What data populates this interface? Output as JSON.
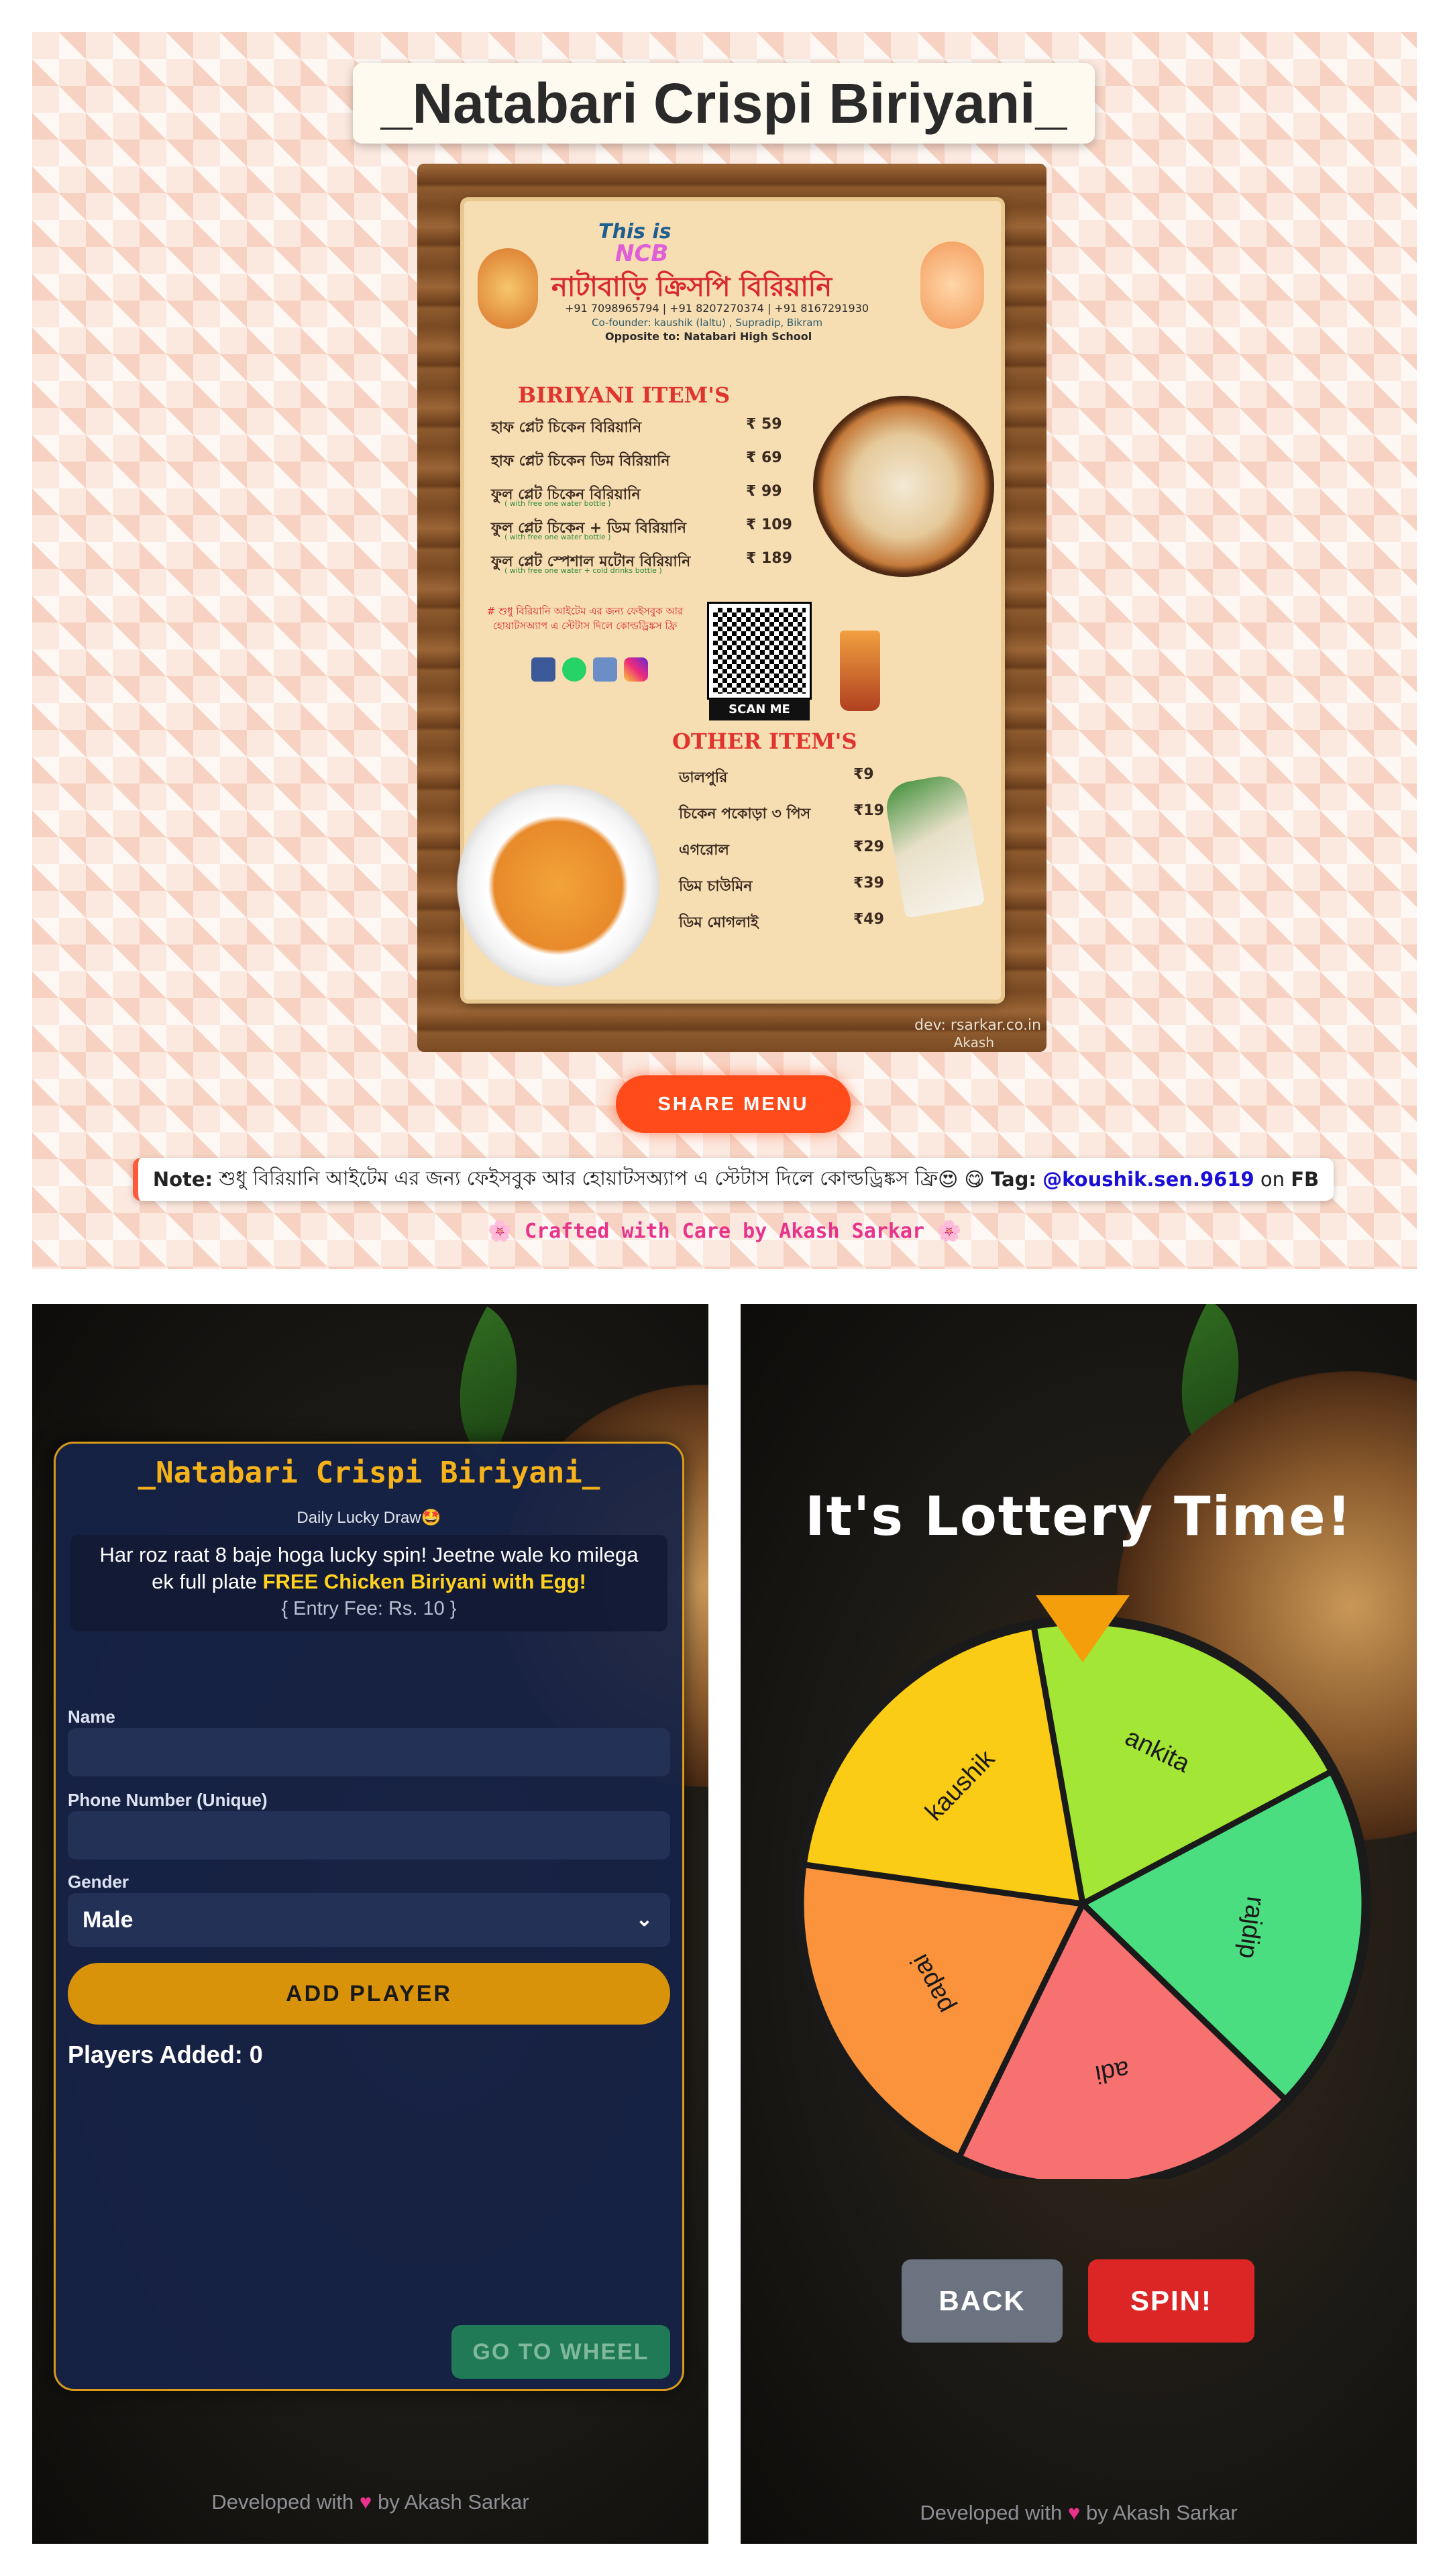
{
  "top": {
    "title": "_Natabari Crispi Biriyani_",
    "menu": {
      "this_is": "This is",
      "ncb": "NCB",
      "restaurant_bengali": "নাটাবাড়ি ক্রিসপি বিরিয়ানি",
      "phones": "+91 7098965794 | +91 8207270374 | +91 8167291930",
      "cofounder": "Co-founder: kaushik (laltu) , Supradip, Bikram",
      "opposite": "Opposite to: Natabari High School",
      "biriyani_heading": "BIRIYANI ITEM'S",
      "biriyani_items": [
        {
          "name": "হাফ প্লেট চিকেন বিরিয়ানি",
          "price": "₹ 59",
          "sub": ""
        },
        {
          "name": "হাফ প্লেট চিকেন ডিম বিরিয়ানি",
          "price": "₹ 69",
          "sub": ""
        },
        {
          "name": "ফুল প্লেট চিকেন বিরিয়ানি",
          "price": "₹ 99",
          "sub": "( with free one water bottle )"
        },
        {
          "name": "ফুল প্লেট চিকেন + ডিম বিরিয়ানি",
          "price": "₹ 109",
          "sub": "( with free one water bottle )"
        },
        {
          "name": "ফুল প্লেট স্পেশাল মটোন বিরিয়ানি",
          "price": "₹ 189",
          "sub": "( with free one water + cold drinks bottle )"
        }
      ],
      "promo_text": "# শুধু বিরিয়ানি আইটেম এর জন্য ফেইসবুক আর হোয়াটসঅ্যাপ এ স্টেটাস দিলে কোল্ডড্রিঙ্কস ফ্রি",
      "scan_me": "SCAN ME",
      "other_heading": "OTHER ITEM'S",
      "other_items": [
        {
          "name": "ডালপুরি",
          "price": "₹9"
        },
        {
          "name": "চিকেন পকোড়া ৩ পিস",
          "price": "₹19"
        },
        {
          "name": "এগরোল",
          "price": "₹29"
        },
        {
          "name": "ডিম চাউমিন",
          "price": "₹39"
        },
        {
          "name": "ডিম মোগলাই",
          "price": "₹49"
        }
      ],
      "dev": "dev: rsarkar.co.in",
      "dev_name": "Akash"
    },
    "share_label": "SHARE MENU",
    "note": {
      "label": "Note:",
      "text": "শুধু বিরিয়ানি আইটেম এর জন্য ফেইসবুক আর হোয়াটসঅ্যাপ এ স্টেটাস দিলে কোল্ডড্রিঙ্কস ফ্রি",
      "emoji": "😍 😋",
      "tag_label": "Tag:",
      "tag_handle": "@koushik.sen.9619",
      "tag_on": "on",
      "tag_platform": "FB"
    },
    "crafted": "🌸 Crafted with Care by Akash Sarkar 🌸"
  },
  "left": {
    "title": "_Natabari Crispi Biriyani_",
    "subtitle": "Daily Lucky Draw🤩",
    "promo_line1": "Har roz raat 8 baje hoga lucky spin! Jeetne wale ko milega",
    "promo_line2a": "ek full plate",
    "promo_highlight": "FREE Chicken Biriyani with Egg!",
    "entry_fee": "{ Entry Fee: Rs. 10 }",
    "name_label": "Name",
    "name_value": "",
    "phone_label": "Phone Number (Unique)",
    "phone_value": "",
    "gender_label": "Gender",
    "gender_value": "Male",
    "add_player": "ADD PLAYER",
    "players_added": "Players Added: 0",
    "go_to_wheel": "GO TO WHEEL",
    "developed_prefix": "Developed with",
    "developed_suffix": "by Akash Sarkar"
  },
  "right": {
    "title": "It's Lottery Time!",
    "wheel": [
      {
        "label": "ankita",
        "color": "#a3e635"
      },
      {
        "label": "rajdip",
        "color": "#4ade80"
      },
      {
        "label": "adi",
        "color": "#f87171"
      },
      {
        "label": "papai",
        "color": "#fb923c"
      },
      {
        "label": "kaushik",
        "color": "#facc15"
      }
    ],
    "pointer_color": "#f59e0b",
    "back": "BACK",
    "spin": "SPIN!",
    "developed_prefix": "Developed with",
    "developed_suffix": "by Akash Sarkar"
  }
}
